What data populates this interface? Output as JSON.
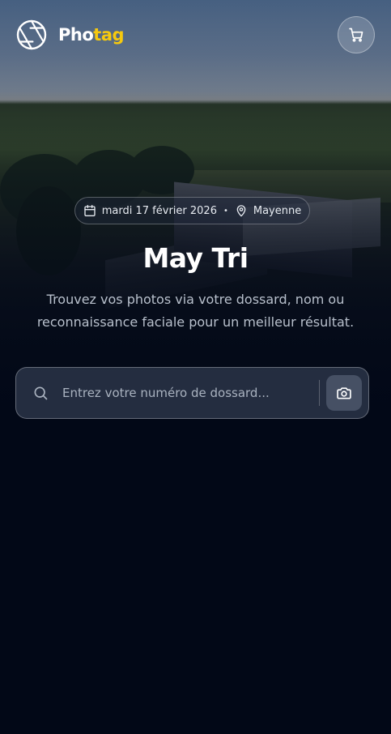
{
  "brand": {
    "name_main": "Pho",
    "name_accent": "tag",
    "accent_color": "#f6c90e",
    "logo_icon": "aperture-icon"
  },
  "header": {
    "cart_icon": "cart-icon"
  },
  "event": {
    "date": "mardi 17 février 2026",
    "separator": "•",
    "location": "Mayenne",
    "title": "May Tri",
    "subtitle": "Trouvez vos photos via votre dossard, nom ou reconnaissance faciale pour un meilleur résultat."
  },
  "search": {
    "placeholder": "Entrez votre numéro de dossard...",
    "value": "",
    "search_icon": "search-icon",
    "camera_icon": "camera-icon"
  },
  "colors": {
    "background": "#020817",
    "text_primary": "#ffffff",
    "text_secondary": "#b8c0cc"
  }
}
